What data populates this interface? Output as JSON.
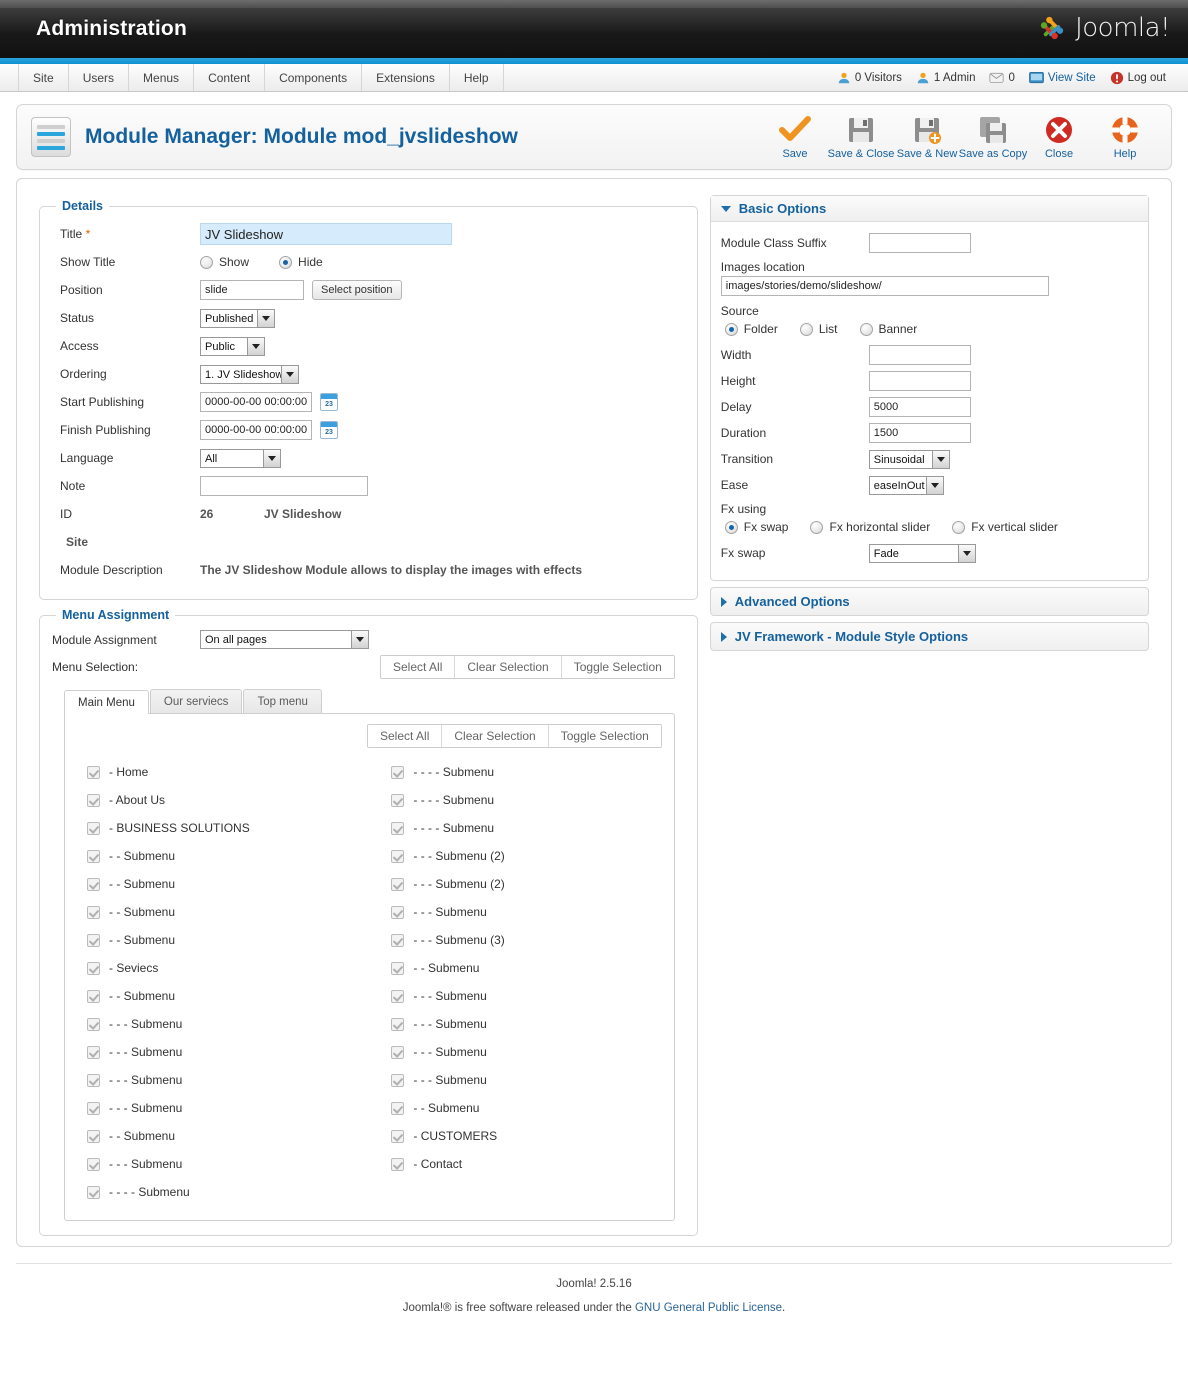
{
  "header": {
    "title": "Administration",
    "brand": "Joomla!",
    "brand_mark": "joomla-logo-icon"
  },
  "menubar": {
    "items": [
      {
        "label": "Site"
      },
      {
        "label": "Users"
      },
      {
        "label": "Menus"
      },
      {
        "label": "Content"
      },
      {
        "label": "Components"
      },
      {
        "label": "Extensions"
      },
      {
        "label": "Help"
      }
    ],
    "status": {
      "visitors": "0 Visitors",
      "admins": "1 Admin",
      "messages": "0",
      "view_site": "View Site",
      "logout": "Log out"
    }
  },
  "subhead": {
    "page_title": "Module Manager: Module mod_jvslideshow",
    "toolbar": [
      {
        "label": "Save",
        "icon": "check-icon"
      },
      {
        "label": "Save & Close",
        "icon": "floppy-icon"
      },
      {
        "label": "Save & New",
        "icon": "floppy-plus-icon"
      },
      {
        "label": "Save as Copy",
        "icon": "floppy-copy-icon"
      },
      {
        "label": "Close",
        "icon": "close-circle-icon"
      },
      {
        "label": "Help",
        "icon": "lifebuoy-icon"
      }
    ]
  },
  "details": {
    "legend": "Details",
    "title_label": "Title",
    "title_required_mark": "*",
    "title_value": "JV Slideshow",
    "show_title_label": "Show Title",
    "show_title_options": [
      {
        "label": "Show",
        "selected": false
      },
      {
        "label": "Hide",
        "selected": true
      }
    ],
    "position_label": "Position",
    "position_value": "slide",
    "select_position_button": "Select position",
    "status_label": "Status",
    "status_value": "Published",
    "access_label": "Access",
    "access_value": "Public",
    "ordering_label": "Ordering",
    "ordering_value": "1. JV Slideshow",
    "start_publishing_label": "Start Publishing",
    "start_publishing_value": "0000-00-00 00:00:00",
    "finish_publishing_label": "Finish Publishing",
    "finish_publishing_value": "0000-00-00 00:00:00",
    "calendar_day": "23",
    "language_label": "Language",
    "language_value": "All",
    "note_label": "Note",
    "note_value": "",
    "id_label": "ID",
    "id_value": "26",
    "id_name": "JV Slideshow",
    "site_label": "Site",
    "module_description_label": "Module Description",
    "module_description_value": "The JV Slideshow Module allows to display the images with effects"
  },
  "basic_options": {
    "legend": "Basic Options",
    "module_class_suffix_label": "Module Class Suffix",
    "module_class_suffix_value": "",
    "images_location_label": "Images location",
    "images_location_value": "images/stories/demo/slideshow/",
    "source_label": "Source",
    "source_options": [
      {
        "label": "Folder",
        "selected": true
      },
      {
        "label": "List",
        "selected": false
      },
      {
        "label": "Banner",
        "selected": false
      }
    ],
    "width_label": "Width",
    "width_value": "",
    "height_label": "Height",
    "height_value": "",
    "delay_label": "Delay",
    "delay_value": "5000",
    "duration_label": "Duration",
    "duration_value": "1500",
    "transition_label": "Transition",
    "transition_value": "Sinusoidal",
    "ease_label": "Ease",
    "ease_value": "easeInOut",
    "fx_using_label": "Fx using",
    "fx_using_options": [
      {
        "label": "Fx swap",
        "selected": true
      },
      {
        "label": "Fx horizontal slider",
        "selected": false
      },
      {
        "label": "Fx vertical slider",
        "selected": false
      }
    ],
    "fx_swap_label": "Fx swap",
    "fx_swap_value": "Fade"
  },
  "collapsed_panels": [
    {
      "label": "Advanced Options"
    },
    {
      "label": "JV Framework - Module Style Options"
    }
  ],
  "menu_assignment": {
    "legend": "Menu Assignment",
    "module_assignment_label": "Module Assignment",
    "module_assignment_value": "On all pages",
    "menu_selection_label": "Menu Selection:",
    "selection_buttons": [
      "Select All",
      "Clear Selection",
      "Toggle Selection"
    ],
    "inner_selection_buttons": [
      "Select All",
      "Clear Selection",
      "Toggle Selection"
    ],
    "tabs": [
      {
        "label": "Main Menu",
        "active": true
      },
      {
        "label": "Our serviecs",
        "active": false
      },
      {
        "label": "Top menu",
        "active": false
      }
    ],
    "items_left": [
      {
        "label": "- Home",
        "checked": true
      },
      {
        "label": "- About Us",
        "checked": true
      },
      {
        "label": "- BUSINESS SOLUTIONS",
        "checked": true
      },
      {
        "label": "- - Submenu",
        "checked": true
      },
      {
        "label": "- - Submenu",
        "checked": true
      },
      {
        "label": "- - Submenu",
        "checked": true
      },
      {
        "label": "- - Submenu",
        "checked": true
      },
      {
        "label": "- Seviecs",
        "checked": true
      },
      {
        "label": "- - Submenu",
        "checked": true
      },
      {
        "label": "- - - Submenu",
        "checked": true
      },
      {
        "label": "- - - Submenu",
        "checked": true
      },
      {
        "label": "- - - Submenu",
        "checked": true
      },
      {
        "label": "- - - Submenu",
        "checked": true
      },
      {
        "label": "- - Submenu",
        "checked": true
      },
      {
        "label": "- - - Submenu",
        "checked": true
      },
      {
        "label": "- - - - Submenu",
        "checked": true
      }
    ],
    "items_right": [
      {
        "label": "- - - - Submenu",
        "checked": true
      },
      {
        "label": "- - - - Submenu",
        "checked": true
      },
      {
        "label": "- - - - Submenu",
        "checked": true
      },
      {
        "label": "- - - Submenu (2)",
        "checked": true
      },
      {
        "label": "- - - Submenu (2)",
        "checked": true
      },
      {
        "label": "- - - Submenu",
        "checked": true
      },
      {
        "label": "- - - Submenu (3)",
        "checked": true
      },
      {
        "label": "- - Submenu",
        "checked": true
      },
      {
        "label": "- - - Submenu",
        "checked": true
      },
      {
        "label": "- - - Submenu",
        "checked": true
      },
      {
        "label": "- - - Submenu",
        "checked": true
      },
      {
        "label": "- - - Submenu",
        "checked": true
      },
      {
        "label": "- - Submenu",
        "checked": true
      },
      {
        "label": "- CUSTOMERS",
        "checked": true
      },
      {
        "label": "- Contact",
        "checked": true
      }
    ]
  },
  "footer": {
    "version": "Joomla! 2.5.16",
    "license_pre": "Joomla!® is free software released under the ",
    "license_link": "GNU General Public License",
    "license_post": "."
  },
  "colors": {
    "accent_blue": "#0d8ecf",
    "link_blue": "#15619e",
    "header_dark": "#191919",
    "title_highlight": "#d6ebfb"
  }
}
